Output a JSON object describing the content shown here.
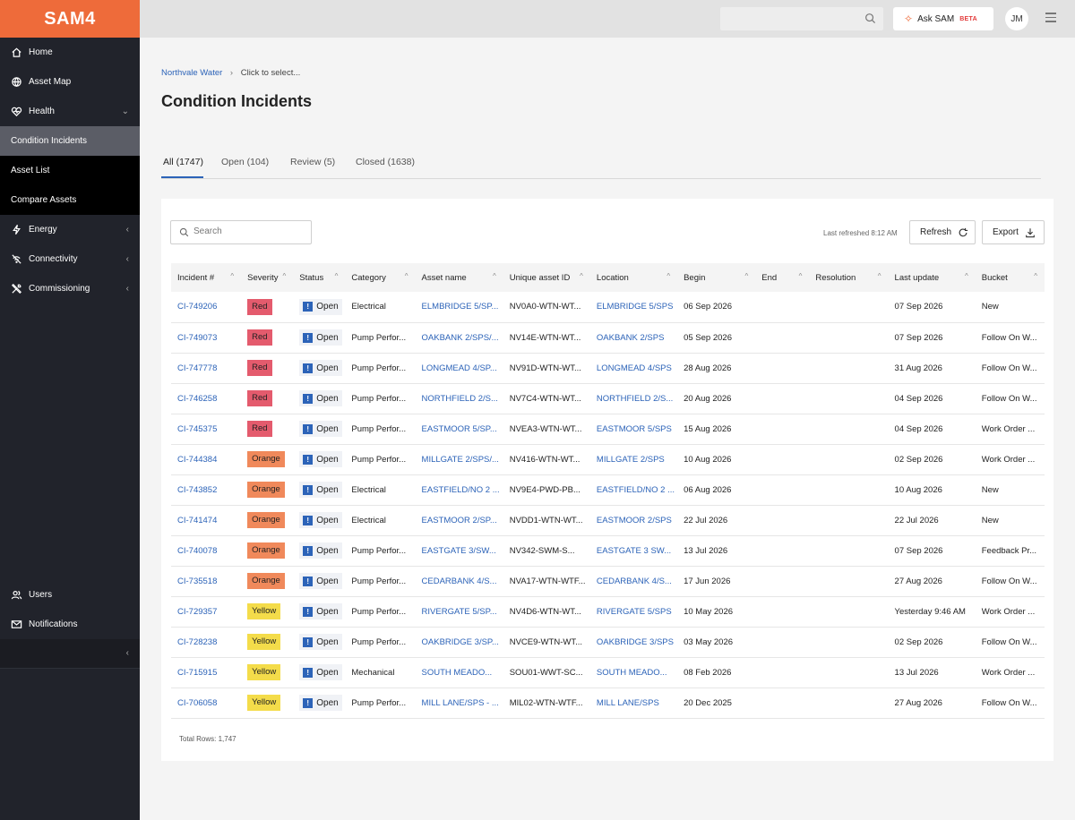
{
  "app": {
    "logo": "SAM4"
  },
  "sidebar": {
    "items": [
      {
        "label": "Home",
        "icon": "home-icon"
      },
      {
        "label": "Asset Map",
        "icon": "globe-icon"
      },
      {
        "label": "Health",
        "icon": "heart-icon",
        "chevron": "⌄"
      },
      {
        "label": "Condition Incidents"
      },
      {
        "label": "Asset List"
      },
      {
        "label": "Compare Assets"
      },
      {
        "label": "Energy",
        "icon": "bolt-icon",
        "chevron": "‹"
      },
      {
        "label": "Connectivity",
        "icon": "signal-off-icon",
        "chevron": "‹"
      },
      {
        "label": "Commissioning",
        "icon": "tools-icon",
        "chevron": "‹"
      }
    ],
    "bottom_items": [
      {
        "label": "Users",
        "icon": "users-icon"
      },
      {
        "label": "Notifications",
        "icon": "mail-icon"
      }
    ],
    "collapse": "‹"
  },
  "topbar": {
    "ask_sam": "Ask SAM",
    "beta": "BETA",
    "avatar": "JM"
  },
  "breadcrumb": {
    "root": "Northvale Water",
    "sep": "›",
    "current": "Click to select..."
  },
  "page_title": "Condition Incidents",
  "tabs": [
    "All (1747)",
    "Open (104)",
    "Review (5)",
    "Closed (1638)"
  ],
  "toolbar": {
    "search_placeholder": "Search",
    "last_refreshed": "Last refreshed 8:12 AM",
    "refresh": "Refresh",
    "export": "Export"
  },
  "table": {
    "columns": [
      "Incident #",
      "Severity",
      "Status",
      "Category",
      "Asset name",
      "Unique asset ID",
      "Location",
      "Begin",
      "End",
      "Resolution",
      "Last update",
      "Bucket"
    ],
    "rows": [
      [
        "CI-749206",
        "Red",
        "Open",
        "Electrical",
        "ELMBRIDGE 5/SP...",
        "NV0A0-WTN-WT...",
        "ELMBRIDGE 5/SPS",
        "06 Sep 2026",
        "",
        "",
        "07 Sep 2026",
        "New"
      ],
      [
        "CI-749073",
        "Red",
        "Open",
        "Pump Perfor...",
        "OAKBANK 2/SPS/...",
        "NV14E-WTN-WT...",
        "OAKBANK 2/SPS",
        "05 Sep 2026",
        "",
        "",
        "07 Sep 2026",
        "Follow On W..."
      ],
      [
        "CI-747778",
        "Red",
        "Open",
        "Pump Perfor...",
        "LONGMEAD 4/SP...",
        "NV91D-WTN-WT...",
        "LONGMEAD 4/SPS",
        "28 Aug 2026",
        "",
        "",
        "31 Aug 2026",
        "Follow On W..."
      ],
      [
        "CI-746258",
        "Red",
        "Open",
        "Pump Perfor...",
        "NORTHFIELD 2/S...",
        "NV7C4-WTN-WT...",
        "NORTHFIELD 2/S...",
        "20 Aug 2026",
        "",
        "",
        "04 Sep 2026",
        "Follow On W..."
      ],
      [
        "CI-745375",
        "Red",
        "Open",
        "Pump Perfor...",
        "EASTMOOR 5/SP...",
        "NVEA3-WTN-WT...",
        "EASTMOOR 5/SPS",
        "15 Aug 2026",
        "",
        "",
        "04 Sep 2026",
        "Work Order ..."
      ],
      [
        "CI-744384",
        "Orange",
        "Open",
        "Pump Perfor...",
        "MILLGATE 2/SPS/...",
        "NV416-WTN-WT...",
        "MILLGATE 2/SPS",
        "10 Aug 2026",
        "",
        "",
        "02 Sep 2026",
        "Work Order ..."
      ],
      [
        "CI-743852",
        "Orange",
        "Open",
        "Electrical",
        "EASTFIELD/NO 2 ...",
        "NV9E4-PWD-PB...",
        "EASTFIELD/NO 2 ...",
        "06 Aug 2026",
        "",
        "",
        "10 Aug 2026",
        "New"
      ],
      [
        "CI-741474",
        "Orange",
        "Open",
        "Electrical",
        "EASTMOOR 2/SP...",
        "NVDD1-WTN-WT...",
        "EASTMOOR 2/SPS",
        "22 Jul 2026",
        "",
        "",
        "22 Jul 2026",
        "New"
      ],
      [
        "CI-740078",
        "Orange",
        "Open",
        "Pump Perfor...",
        "EASTGATE 3/SW...",
        "NV342-SWM-S...",
        "EASTGATE 3 SW...",
        "13 Jul 2026",
        "",
        "",
        "07 Sep 2026",
        "Feedback Pr..."
      ],
      [
        "CI-735518",
        "Orange",
        "Open",
        "Pump Perfor...",
        "CEDARBANK 4/S...",
        "NVA17-WTN-WTF...",
        "CEDARBANK 4/S...",
        "17 Jun 2026",
        "",
        "",
        "27 Aug 2026",
        "Follow On W..."
      ],
      [
        "CI-729357",
        "Yellow",
        "Open",
        "Pump Perfor...",
        "RIVERGATE 5/SP...",
        "NV4D6-WTN-WT...",
        "RIVERGATE 5/SPS",
        "10 May 2026",
        "",
        "",
        "Yesterday 9:46 AM",
        "Work Order ..."
      ],
      [
        "CI-728238",
        "Yellow",
        "Open",
        "Pump Perfor...",
        "OAKBRIDGE 3/SP...",
        "NVCE9-WTN-WT...",
        "OAKBRIDGE 3/SPS",
        "03 May 2026",
        "",
        "",
        "02 Sep 2026",
        "Follow On W..."
      ],
      [
        "CI-715915",
        "Yellow",
        "Open",
        "Mechanical",
        "SOUTH MEADO...",
        "SOU01-WWT-SC...",
        "SOUTH MEADO...",
        "08 Feb 2026",
        "",
        "",
        "13 Jul 2026",
        "Work Order ..."
      ],
      [
        "CI-706058",
        "Yellow",
        "Open",
        "Pump Perfor...",
        "MILL LANE/SPS - ...",
        "MIL02-WTN-WTF...",
        "MILL LANE/SPS",
        "20 Dec 2025",
        "",
        "",
        "27 Aug 2026",
        "Follow On W..."
      ]
    ],
    "total_rows": "Total Rows: 1,747"
  },
  "colors": {
    "brand": "#ee6b3a",
    "link": "#2c63b8",
    "red": "#e45b6d",
    "orange": "#f0895b",
    "yellow": "#f4dc4a"
  }
}
